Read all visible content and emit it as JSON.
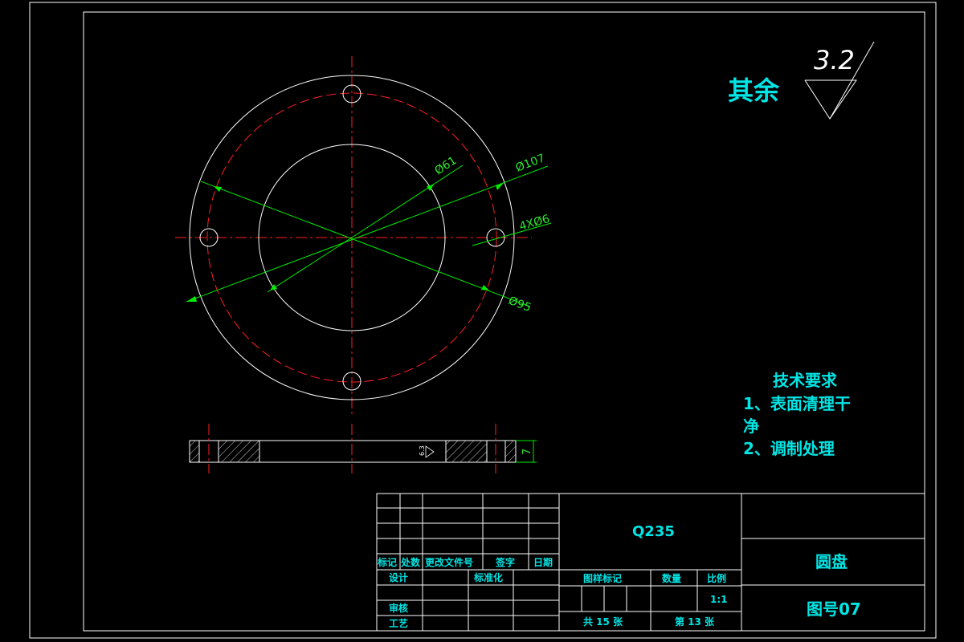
{
  "roughness": {
    "label": "其余",
    "value": "3.2"
  },
  "dimensions": {
    "d61": "Ø61",
    "d107": "Ø107",
    "holes": "4XØ6",
    "d95": "Ø95",
    "thickness": "7",
    "section_roughness": "6.3"
  },
  "tech_requirements": {
    "title": "技术要求",
    "line1": "1、表面清理干",
    "line2": "净",
    "line3": "2、调制处理"
  },
  "title_block": {
    "material": "Q235",
    "part_name": "圆盘",
    "drawing_number": "图号07",
    "headers": {
      "mark": "标记",
      "count": "处数",
      "change_doc": "更改文件号",
      "signature": "签字",
      "date": "日期",
      "design": "设计",
      "standardize": "标准化",
      "review": "审核",
      "process": "工艺",
      "stage_mark": "图样标记",
      "quantity": "数量",
      "scale_label": "比例",
      "scale_value": "1:1",
      "total_sheets": "共 15 张",
      "sheet_no": "第 13 张"
    }
  }
}
